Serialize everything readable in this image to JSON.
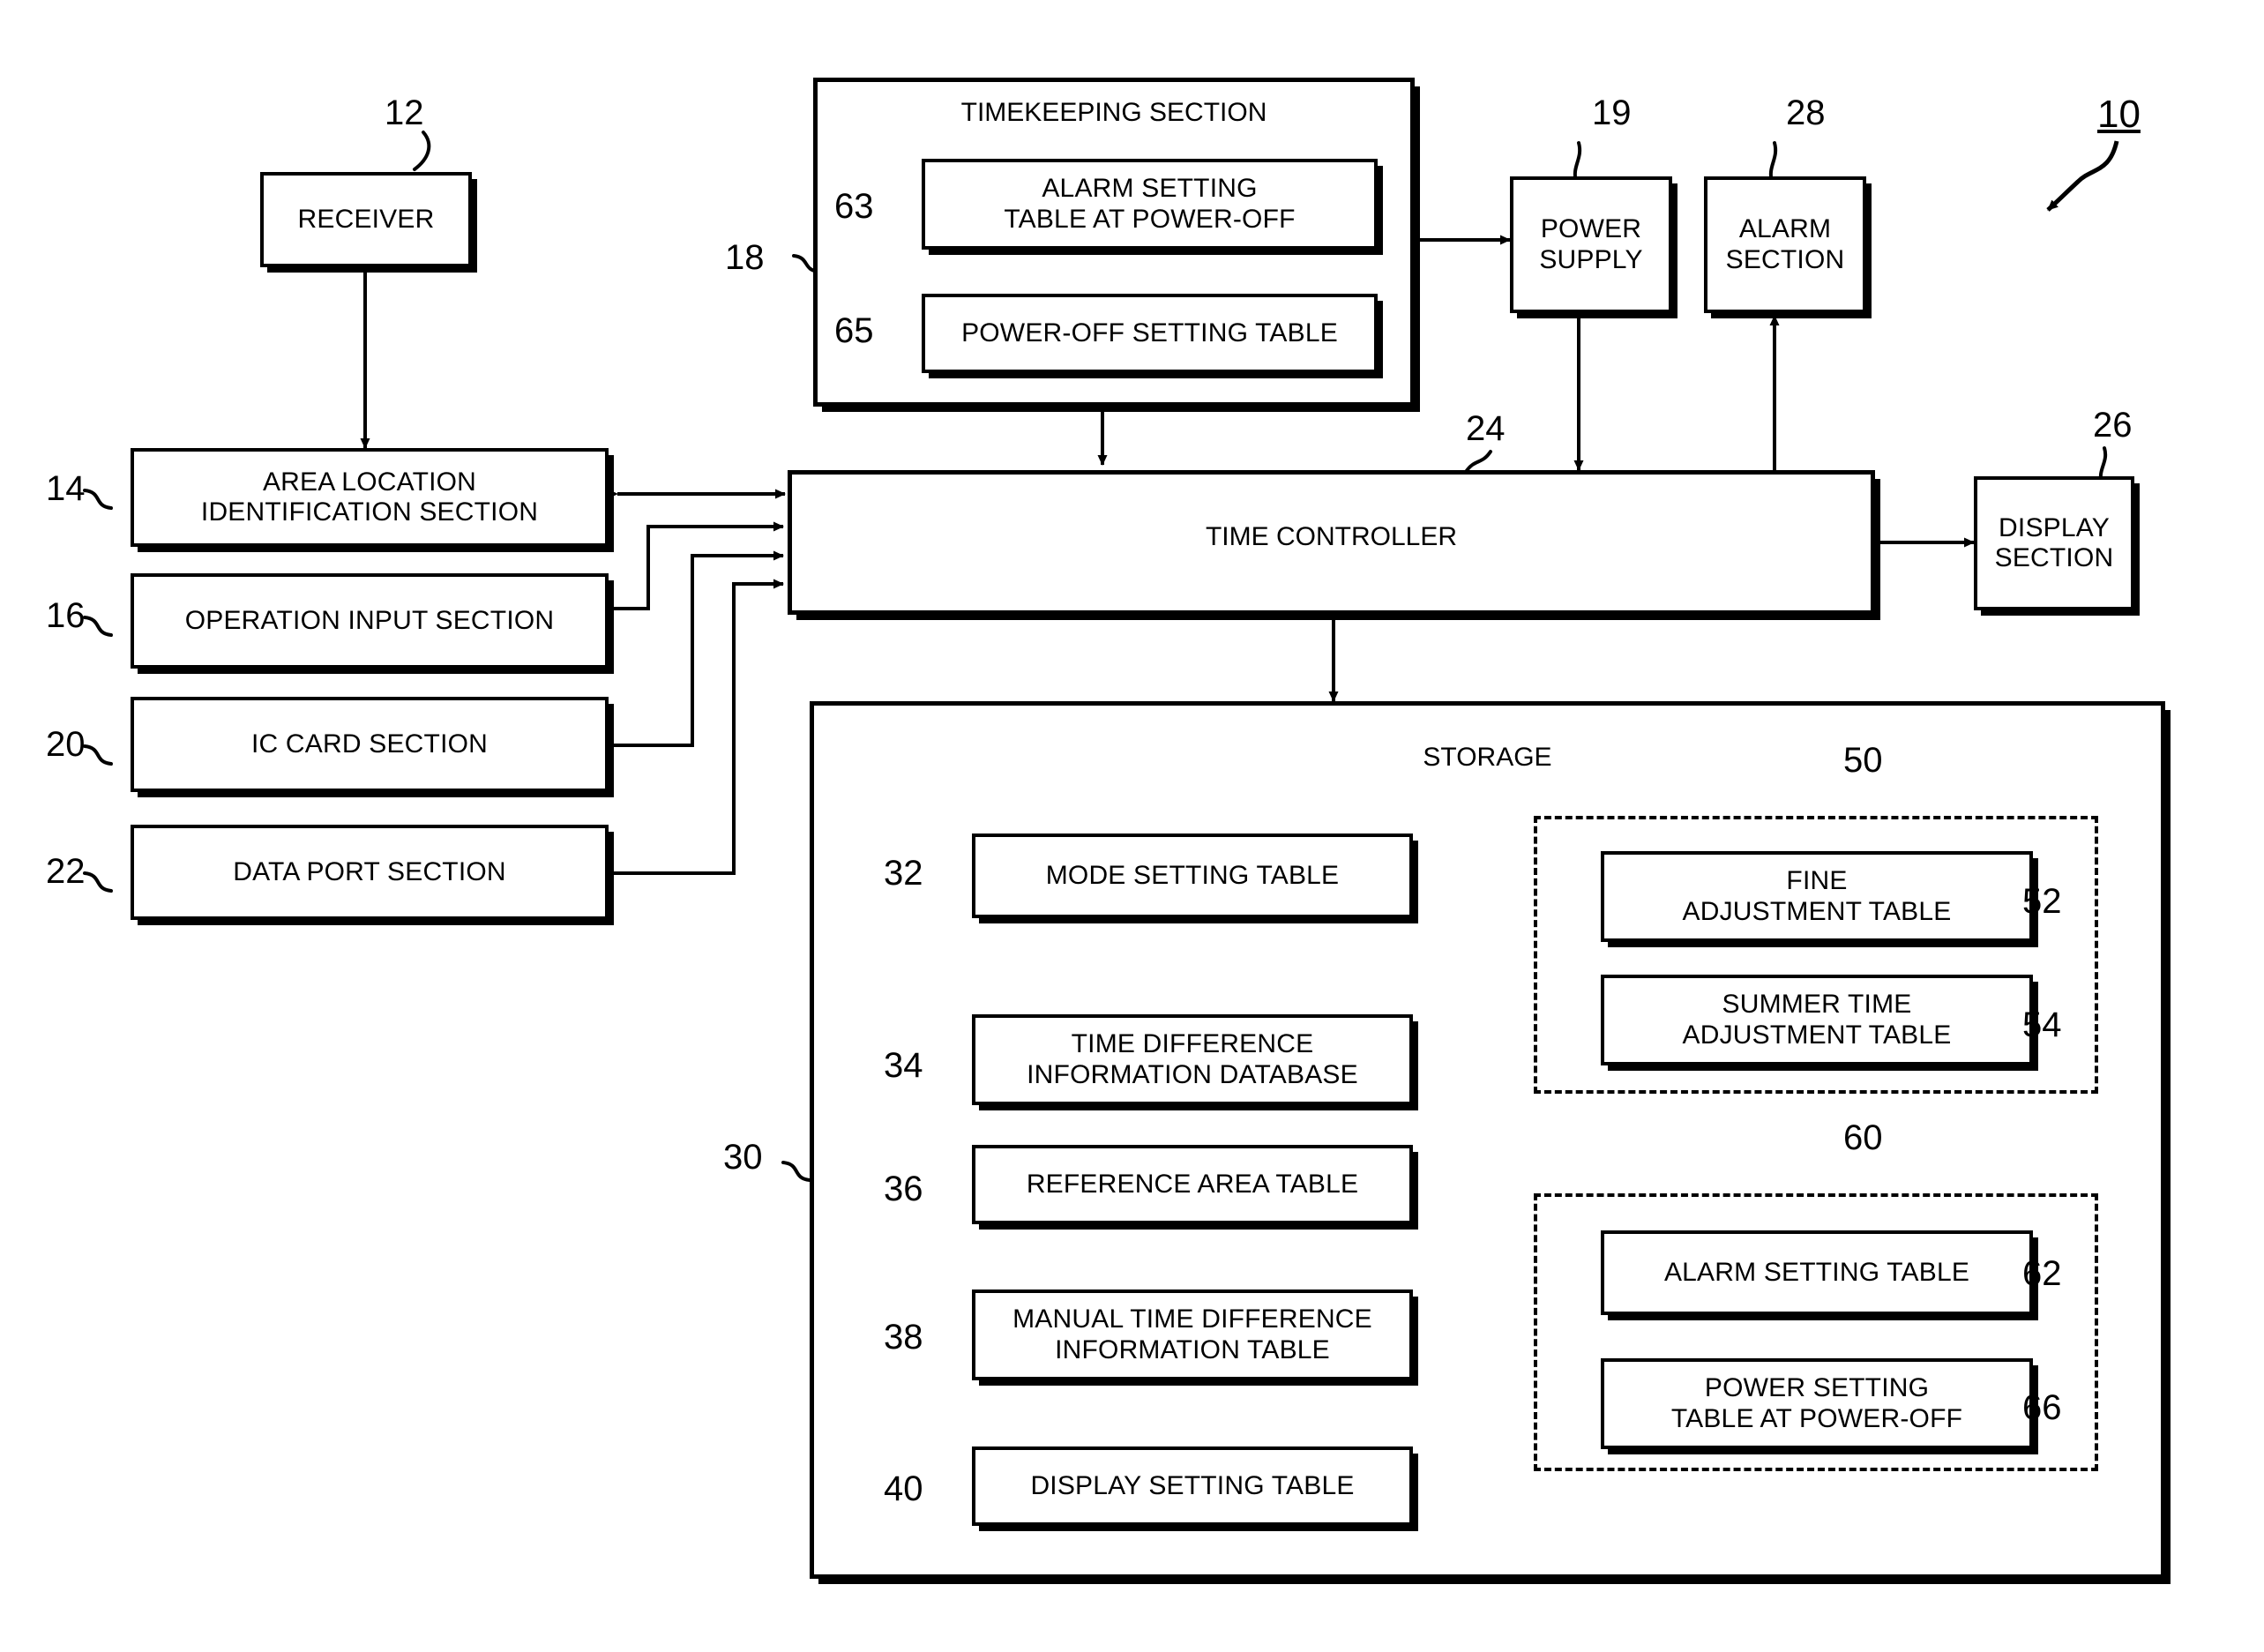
{
  "figure": {
    "system_ref": "10"
  },
  "blocks": {
    "receiver": {
      "ref": "12",
      "label": "RECEIVER"
    },
    "timekeeping": {
      "ref": "18",
      "label": "TIMEKEEPING SECTION"
    },
    "alarm_setting_po": {
      "ref": "63",
      "line1": "ALARM SETTING",
      "line2": "TABLE AT POWER-OFF"
    },
    "power_off_table": {
      "ref": "65",
      "label": "POWER-OFF SETTING TABLE"
    },
    "power_supply": {
      "ref": "19",
      "line1": "POWER",
      "line2": "SUPPLY"
    },
    "alarm_section": {
      "ref": "28",
      "line1": "ALARM",
      "line2": "SECTION"
    },
    "area_location": {
      "ref": "14",
      "line1": "AREA LOCATION",
      "line2": "IDENTIFICATION SECTION"
    },
    "operation_input": {
      "ref": "16",
      "label": "OPERATION INPUT SECTION"
    },
    "ic_card": {
      "ref": "20",
      "label": "IC CARD SECTION"
    },
    "data_port": {
      "ref": "22",
      "label": "DATA PORT SECTION"
    },
    "time_controller": {
      "ref": "24",
      "label": "TIME CONTROLLER"
    },
    "display_section": {
      "ref": "26",
      "line1": "DISPLAY",
      "line2": "SECTION"
    },
    "storage": {
      "ref": "30",
      "label": "STORAGE"
    },
    "mode_setting": {
      "ref": "32",
      "label": "MODE SETTING TABLE"
    },
    "time_diff_db": {
      "ref": "34",
      "line1": "TIME DIFFERENCE",
      "line2": "INFORMATION DATABASE"
    },
    "reference_area": {
      "ref": "36",
      "label": "REFERENCE AREA TABLE"
    },
    "manual_time_diff": {
      "ref": "38",
      "line1": "MANUAL TIME DIFFERENCE",
      "line2": "INFORMATION TABLE"
    },
    "display_setting": {
      "ref": "40",
      "label": "DISPLAY SETTING TABLE"
    },
    "adjust_group": {
      "ref": "50"
    },
    "fine_adjust": {
      "ref": "52",
      "line1": "FINE",
      "line2": "ADJUSTMENT TABLE"
    },
    "summer_adjust": {
      "ref": "54",
      "line1": "SUMMER TIME",
      "line2": "ADJUSTMENT TABLE"
    },
    "setting_group": {
      "ref": "60"
    },
    "alarm_setting": {
      "ref": "62",
      "label": "ALARM SETTING TABLE"
    },
    "power_setting_po": {
      "ref": "66",
      "line1": "POWER SETTING",
      "line2": "TABLE AT POWER-OFF"
    }
  }
}
